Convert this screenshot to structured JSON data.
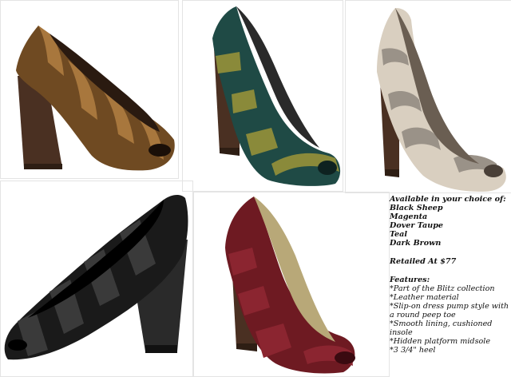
{
  "colors": {
    "bronze": "#6f4a22",
    "bronze_light": "#a8773d",
    "teal": "#1f4a45",
    "olive": "#8a8a3a",
    "taupe": "#d9cfc0",
    "pewter": "#9a9288",
    "black": "#1a1a1a",
    "magenta": "#6e1a22",
    "wood": "#4a3022"
  },
  "products": [
    {
      "name": "Dark Brown",
      "icon": "shoe-bronze-icon"
    },
    {
      "name": "Teal",
      "icon": "shoe-teal-icon"
    },
    {
      "name": "Dover Taupe",
      "icon": "shoe-taupe-icon"
    },
    {
      "name": "Black Sheep",
      "icon": "shoe-black-icon"
    },
    {
      "name": "Magenta",
      "icon": "shoe-magenta-icon"
    }
  ],
  "info": {
    "heading": "Available in your choice of:",
    "options": [
      "Black Sheep",
      "Magenta",
      "Dover Taupe",
      "Teal",
      "Dark Brown"
    ],
    "retail": "Retailed At $77",
    "features_title": "Features:",
    "features": [
      "*Part of the Blitz collection",
      "*Leather material",
      "*Slip-on dress pump style with a round peep toe",
      "*Smooth lining, cushioned insole",
      "*Hidden platform midsole",
      "*3 3/4\" heel"
    ]
  }
}
